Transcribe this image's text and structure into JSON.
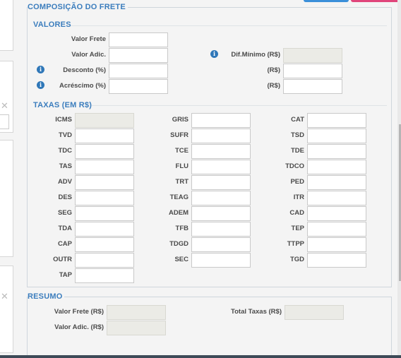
{
  "frete": {
    "legend": "COMPOSIÇÃO DO FRETE",
    "valores": {
      "title": "VALORES",
      "valor_frete": {
        "label": "Valor Frete",
        "value": ""
      },
      "valor_adic": {
        "label": "Valor Adic.",
        "value": ""
      },
      "desconto": {
        "label": "Desconto (%)",
        "value": ""
      },
      "acrescimo": {
        "label": "Acréscimo (%)",
        "value": ""
      },
      "dif_minimo": {
        "label": "Dif.Mínimo (R$)",
        "value": ""
      },
      "desconto_rs": {
        "label": "(R$)",
        "value": ""
      },
      "acrescimo_rs": {
        "label": "(R$)",
        "value": ""
      }
    },
    "taxas": {
      "title": "TAXAS (EM R$)",
      "col1": [
        "ICMS",
        "TVD",
        "TDC",
        "TAS",
        "ADV",
        "DES",
        "SEG",
        "TDA",
        "CAP",
        "OUTR",
        "TAP"
      ],
      "col2": [
        "GRIS",
        "SUFR",
        "TCE",
        "FLU",
        "TRT",
        "TEAG",
        "ADEM",
        "TFB",
        "TDGD",
        "SEC"
      ],
      "col3": [
        "CAT",
        "TSD",
        "TDE",
        "TDCO",
        "PED",
        "ITR",
        "CAD",
        "TEP",
        "TTPP",
        "TGD"
      ]
    }
  },
  "resumo": {
    "legend": "RESUMO",
    "valor_frete": {
      "label": "Valor Frete (R$)",
      "value": ""
    },
    "valor_adic": {
      "label": "Valor Adic. (R$)",
      "value": ""
    },
    "total_taxas": {
      "label": "Total Taxas (R$)",
      "value": ""
    }
  },
  "icons": {
    "info": "info-circle-icon",
    "close": "close-icon"
  },
  "colors": {
    "accent": "#3b7dbd",
    "info": "#2f77b8",
    "disabled_input": "#ebebe6"
  }
}
